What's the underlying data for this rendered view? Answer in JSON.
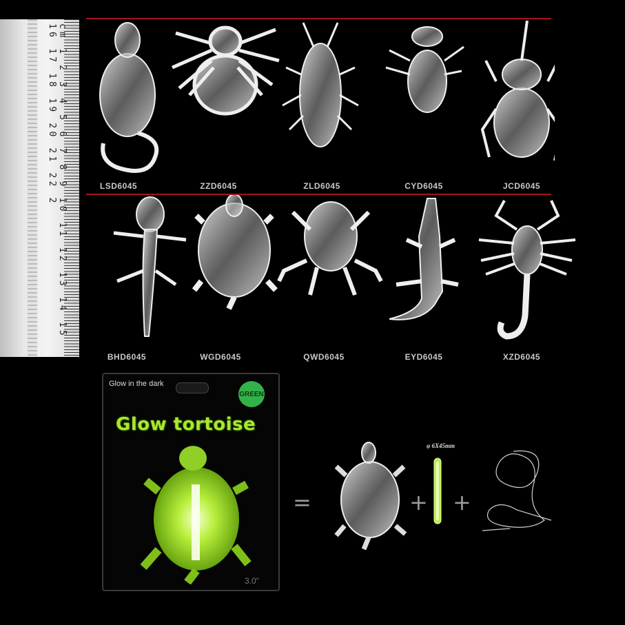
{
  "ruler": {
    "numbers": "cm 1 2 3 4 5 6 7 8 9 10 11 12 13 14 15 16 17 18 19 20 21 22 2"
  },
  "row1": [
    {
      "code": "LSD6045",
      "animal": "mouse-icon"
    },
    {
      "code": "ZZD6045",
      "animal": "spider-icon"
    },
    {
      "code": "ZLD6045",
      "animal": "cockroach-icon"
    },
    {
      "code": "CYD6045",
      "animal": "fly-icon"
    },
    {
      "code": "JCD6045",
      "animal": "beetle-icon"
    }
  ],
  "row2": [
    {
      "code": "BHD6045",
      "animal": "gecko-icon"
    },
    {
      "code": "WGD6045",
      "animal": "tortoise-icon"
    },
    {
      "code": "QWD6045",
      "animal": "frog-icon"
    },
    {
      "code": "EYD6045",
      "animal": "crocodile-icon"
    },
    {
      "code": "XZD6045",
      "animal": "scorpion-icon"
    }
  ],
  "package": {
    "tagline": "Glow in the dark",
    "badge": "GREEN",
    "title": "Glow tortoise",
    "size": "3.0\""
  },
  "equation": {
    "equals": "=",
    "plus": "+",
    "stick_dim": "φ 6X45mm"
  },
  "colors": {
    "accent_line": "#a0161b",
    "glow": "#a8e830",
    "badge": "#34b24a"
  }
}
